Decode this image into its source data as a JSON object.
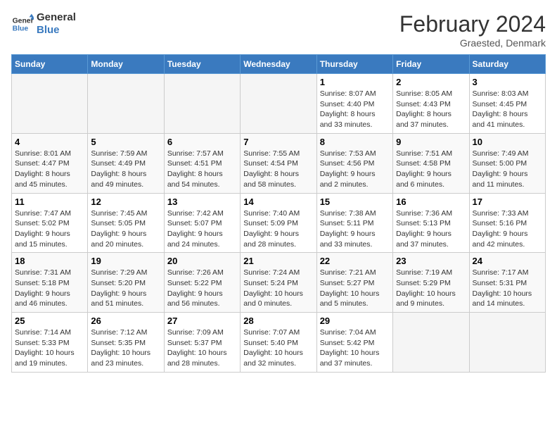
{
  "logo": {
    "text_general": "General",
    "text_blue": "Blue"
  },
  "title": "February 2024",
  "subtitle": "Graested, Denmark",
  "headers": [
    "Sunday",
    "Monday",
    "Tuesday",
    "Wednesday",
    "Thursday",
    "Friday",
    "Saturday"
  ],
  "weeks": [
    [
      {
        "day": "",
        "info": ""
      },
      {
        "day": "",
        "info": ""
      },
      {
        "day": "",
        "info": ""
      },
      {
        "day": "",
        "info": ""
      },
      {
        "day": "1",
        "info": "Sunrise: 8:07 AM\nSunset: 4:40 PM\nDaylight: 8 hours\nand 33 minutes."
      },
      {
        "day": "2",
        "info": "Sunrise: 8:05 AM\nSunset: 4:43 PM\nDaylight: 8 hours\nand 37 minutes."
      },
      {
        "day": "3",
        "info": "Sunrise: 8:03 AM\nSunset: 4:45 PM\nDaylight: 8 hours\nand 41 minutes."
      }
    ],
    [
      {
        "day": "4",
        "info": "Sunrise: 8:01 AM\nSunset: 4:47 PM\nDaylight: 8 hours\nand 45 minutes."
      },
      {
        "day": "5",
        "info": "Sunrise: 7:59 AM\nSunset: 4:49 PM\nDaylight: 8 hours\nand 49 minutes."
      },
      {
        "day": "6",
        "info": "Sunrise: 7:57 AM\nSunset: 4:51 PM\nDaylight: 8 hours\nand 54 minutes."
      },
      {
        "day": "7",
        "info": "Sunrise: 7:55 AM\nSunset: 4:54 PM\nDaylight: 8 hours\nand 58 minutes."
      },
      {
        "day": "8",
        "info": "Sunrise: 7:53 AM\nSunset: 4:56 PM\nDaylight: 9 hours\nand 2 minutes."
      },
      {
        "day": "9",
        "info": "Sunrise: 7:51 AM\nSunset: 4:58 PM\nDaylight: 9 hours\nand 6 minutes."
      },
      {
        "day": "10",
        "info": "Sunrise: 7:49 AM\nSunset: 5:00 PM\nDaylight: 9 hours\nand 11 minutes."
      }
    ],
    [
      {
        "day": "11",
        "info": "Sunrise: 7:47 AM\nSunset: 5:02 PM\nDaylight: 9 hours\nand 15 minutes."
      },
      {
        "day": "12",
        "info": "Sunrise: 7:45 AM\nSunset: 5:05 PM\nDaylight: 9 hours\nand 20 minutes."
      },
      {
        "day": "13",
        "info": "Sunrise: 7:42 AM\nSunset: 5:07 PM\nDaylight: 9 hours\nand 24 minutes."
      },
      {
        "day": "14",
        "info": "Sunrise: 7:40 AM\nSunset: 5:09 PM\nDaylight: 9 hours\nand 28 minutes."
      },
      {
        "day": "15",
        "info": "Sunrise: 7:38 AM\nSunset: 5:11 PM\nDaylight: 9 hours\nand 33 minutes."
      },
      {
        "day": "16",
        "info": "Sunrise: 7:36 AM\nSunset: 5:13 PM\nDaylight: 9 hours\nand 37 minutes."
      },
      {
        "day": "17",
        "info": "Sunrise: 7:33 AM\nSunset: 5:16 PM\nDaylight: 9 hours\nand 42 minutes."
      }
    ],
    [
      {
        "day": "18",
        "info": "Sunrise: 7:31 AM\nSunset: 5:18 PM\nDaylight: 9 hours\nand 46 minutes."
      },
      {
        "day": "19",
        "info": "Sunrise: 7:29 AM\nSunset: 5:20 PM\nDaylight: 9 hours\nand 51 minutes."
      },
      {
        "day": "20",
        "info": "Sunrise: 7:26 AM\nSunset: 5:22 PM\nDaylight: 9 hours\nand 56 minutes."
      },
      {
        "day": "21",
        "info": "Sunrise: 7:24 AM\nSunset: 5:24 PM\nDaylight: 10 hours\nand 0 minutes."
      },
      {
        "day": "22",
        "info": "Sunrise: 7:21 AM\nSunset: 5:27 PM\nDaylight: 10 hours\nand 5 minutes."
      },
      {
        "day": "23",
        "info": "Sunrise: 7:19 AM\nSunset: 5:29 PM\nDaylight: 10 hours\nand 9 minutes."
      },
      {
        "day": "24",
        "info": "Sunrise: 7:17 AM\nSunset: 5:31 PM\nDaylight: 10 hours\nand 14 minutes."
      }
    ],
    [
      {
        "day": "25",
        "info": "Sunrise: 7:14 AM\nSunset: 5:33 PM\nDaylight: 10 hours\nand 19 minutes."
      },
      {
        "day": "26",
        "info": "Sunrise: 7:12 AM\nSunset: 5:35 PM\nDaylight: 10 hours\nand 23 minutes."
      },
      {
        "day": "27",
        "info": "Sunrise: 7:09 AM\nSunset: 5:37 PM\nDaylight: 10 hours\nand 28 minutes."
      },
      {
        "day": "28",
        "info": "Sunrise: 7:07 AM\nSunset: 5:40 PM\nDaylight: 10 hours\nand 32 minutes."
      },
      {
        "day": "29",
        "info": "Sunrise: 7:04 AM\nSunset: 5:42 PM\nDaylight: 10 hours\nand 37 minutes."
      },
      {
        "day": "",
        "info": ""
      },
      {
        "day": "",
        "info": ""
      }
    ]
  ]
}
